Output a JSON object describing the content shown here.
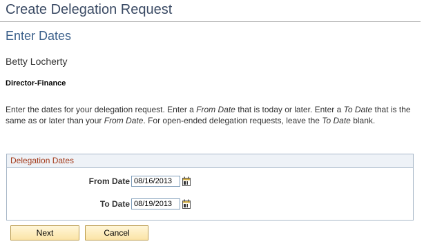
{
  "page": {
    "title": "Create Delegation Request",
    "subtitle": "Enter Dates"
  },
  "person": {
    "name": "Betty Locherty",
    "job_title": "Director-Finance"
  },
  "instructions": {
    "p1": "Enter the dates for your delegation request. Enter a ",
    "from_date_em1": "From Date",
    "p2": " that is today or later. Enter a ",
    "to_date_em1": "To Date",
    "p3": " that is the same as or later than your ",
    "from_date_em2": "From Date",
    "p4": ". For open-ended delegation requests, leave the ",
    "to_date_em2": "To Date",
    "p5": " blank."
  },
  "delegation_dates": {
    "header": "Delegation Dates",
    "from_label": "From Date",
    "from_value": "08/16/2013",
    "to_label": "To Date",
    "to_value": "08/19/2013",
    "calendar_icon": "calendar-icon"
  },
  "buttons": {
    "next": "Next",
    "cancel": "Cancel"
  },
  "colors": {
    "title": "#3a4a64",
    "subtitle": "#3a5f8a",
    "group_header_text": "#a33a1a",
    "button_border": "#b99a4a"
  }
}
